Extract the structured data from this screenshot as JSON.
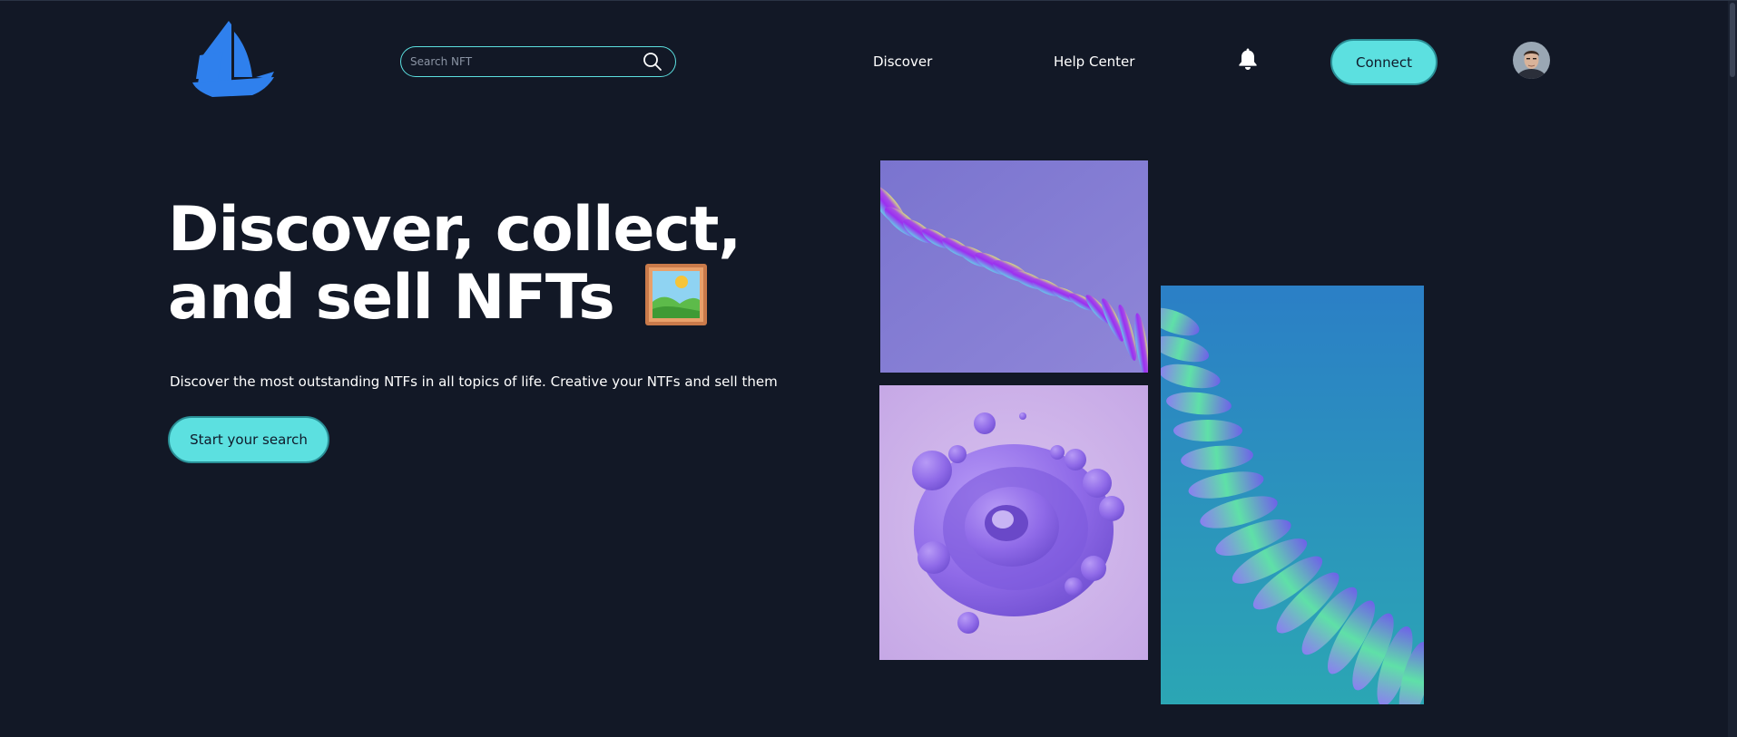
{
  "header": {
    "logo_icon": "sailboat-logo-icon",
    "search": {
      "placeholder": "Search NFT",
      "value": "",
      "icon": "search-icon"
    },
    "nav": [
      {
        "label": "Discover"
      },
      {
        "label": "Help Center"
      }
    ],
    "notification_icon": "bell-icon",
    "connect_label": "Connect",
    "avatar_icon": "user-avatar"
  },
  "hero": {
    "title_line1": "Discover, collect,",
    "title_line2": "and sell NFTs",
    "title_icon": "framed-picture-icon",
    "subtitle": "Discover the most outstanding NTFs in all topics of life. Creative your NTFs and sell them",
    "cta_label": "Start your search"
  },
  "gallery": [
    {
      "name": "purple-ribbon-artwork"
    },
    {
      "name": "lilac-bubble-swirl-artwork"
    },
    {
      "name": "teal-wave-artwork"
    }
  ],
  "colors": {
    "background": "#121826",
    "accent": "#5ce0e0",
    "logo": "#2f80ed",
    "text": "#ffffff"
  }
}
